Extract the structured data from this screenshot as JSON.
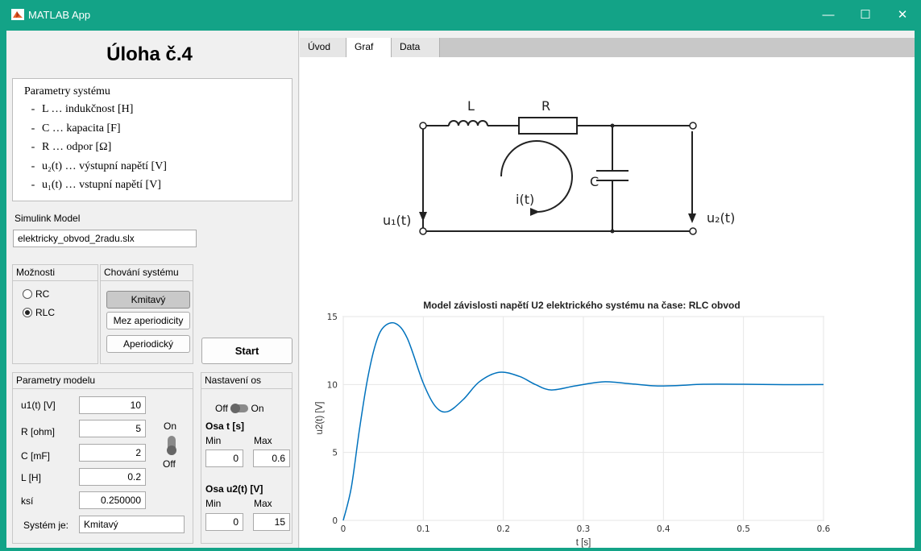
{
  "window": {
    "title": "MATLAB App",
    "minimize": "—",
    "maximize": "☐",
    "close": "✕"
  },
  "left": {
    "heading": "Úloha č.4",
    "params": {
      "title": "Parametry systému",
      "items": [
        "L … indukčnost [H]",
        "C … kapacita [F]",
        "R … odpor [Ω]",
        "u₂(t) … výstupní napětí [V]",
        "u₁(t) … vstupní napětí [V]"
      ]
    },
    "simulink": {
      "label": "Simulink Model",
      "value": "elektricky_obvod_2radu.slx"
    },
    "options": {
      "title": "Možnosti",
      "rc": "RC",
      "rlc": "RLC",
      "selected": "RLC"
    },
    "behavior": {
      "title": "Chování systému",
      "b1": "Kmitavý",
      "b2": "Mez aperiodicity",
      "b3": "Aperiodický"
    },
    "start": "Start",
    "model": {
      "title": "Parametry modelu",
      "u1_label": "u1(t) [V]",
      "u1": "10",
      "r_label": "R [ohm]",
      "r": "5",
      "c_label": "C [mF]",
      "c": "2",
      "l_label": "L [H]",
      "l": "0.2",
      "ksi_label": "ksí",
      "ksi": "0.250000",
      "sys_label": "Systém je:",
      "sys": "Kmitavý",
      "sw_on": "On",
      "sw_off": "Off"
    },
    "axes": {
      "title": "Nastavení os",
      "off": "Off",
      "on": "On",
      "t_title": "Osa t [s]",
      "min": "Min",
      "max": "Max",
      "t_min": "0",
      "t_max": "0.6",
      "u_title": "Osa u2(t) [V]",
      "u_min": "0",
      "u_max": "15"
    }
  },
  "tabs": [
    "Úvod",
    "Graf",
    "Data"
  ],
  "circuit": {
    "L": "L",
    "R": "R",
    "C": "C",
    "i": "i(t)",
    "u1": "u₁(t)",
    "u2": "u₂(t)"
  },
  "chart_data": {
    "type": "line",
    "title": "Model závislosti napětí U2 elektrického systému na čase: RLC obvod",
    "xlabel": "t [s]",
    "ylabel": "u2(t) [V]",
    "xlim": [
      0,
      0.6
    ],
    "ylim": [
      0,
      15
    ],
    "xticks": [
      "0",
      "0.1",
      "0.2",
      "0.3",
      "0.4",
      "0.5",
      "0.6"
    ],
    "yticks": [
      "0",
      "5",
      "10",
      "15"
    ],
    "grid": true,
    "color": "#0072bd",
    "x": [
      0,
      0.01,
      0.02,
      0.03,
      0.04,
      0.05,
      0.065,
      0.08,
      0.1,
      0.115,
      0.13,
      0.15,
      0.17,
      0.195,
      0.22,
      0.24,
      0.26,
      0.29,
      0.325,
      0.36,
      0.39,
      0.42,
      0.45,
      0.5,
      0.55,
      0.6
    ],
    "y": [
      0,
      2.4,
      6.6,
      10.3,
      12.9,
      14.2,
      14.5,
      13.4,
      10.1,
      8.4,
      8.0,
      8.9,
      10.2,
      10.9,
      10.6,
      10.0,
      9.6,
      9.9,
      10.2,
      10.05,
      9.9,
      9.93,
      10.02,
      10.02,
      9.99,
      10.0
    ]
  }
}
